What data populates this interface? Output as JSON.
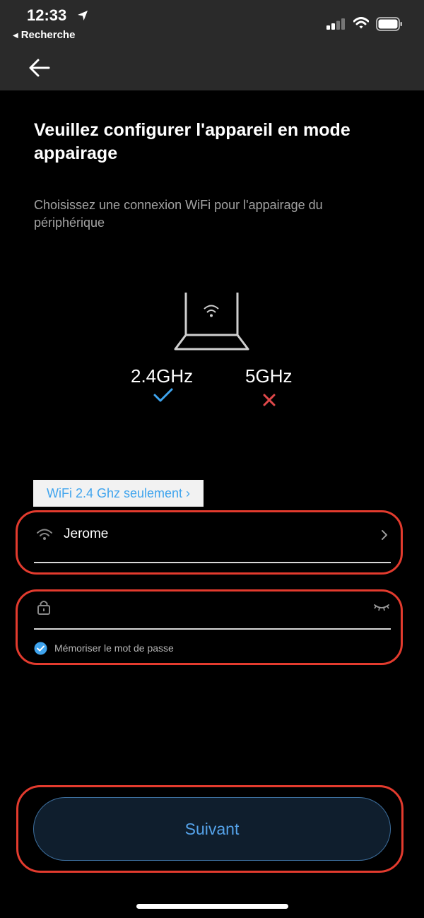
{
  "status_bar": {
    "time": "12:33",
    "back_app_label": "Recherche",
    "icons": [
      "location-arrow-icon",
      "cellular-signal-icon",
      "wifi-icon",
      "battery-icon"
    ]
  },
  "nav": {
    "back_icon": "arrow-left-icon"
  },
  "page": {
    "title": "Veuillez configurer l'appareil en mode appairage",
    "subtitle": "Choisissez une connexion WiFi pour l'appairage du périphérique"
  },
  "bands": {
    "band_24": {
      "value": "2.4",
      "unit": "GHz",
      "supported": true,
      "status_icon": "check-icon"
    },
    "band_5": {
      "value": "5",
      "unit": "GHz",
      "supported": false,
      "status_icon": "cross-icon"
    },
    "illustration_icon": "router-icon"
  },
  "form": {
    "wifi_only_link": "WiFi 2.4 Ghz seulement ›",
    "ssid_value": "Jerome",
    "password_value": "",
    "remember_password_label": "Mémoriser le mot de passe",
    "remember_password_checked": true
  },
  "actions": {
    "next_label": "Suivant"
  },
  "colors": {
    "accent": "#3fa4ee",
    "annotation_red": "#e33b2e",
    "error_red": "#e0484a",
    "background": "#000000",
    "nav_bg": "#2a2a2a"
  }
}
